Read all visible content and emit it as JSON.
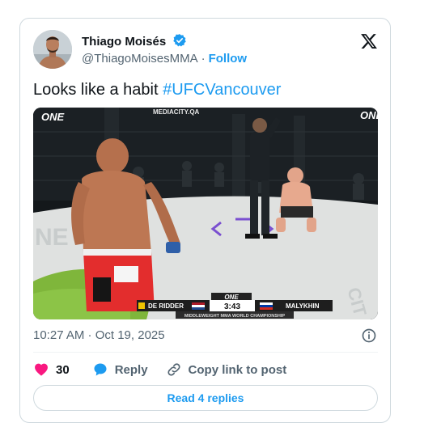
{
  "author": {
    "name": "Thiago Moisés",
    "handle": "@ThiagoMoisesMMA",
    "separator": "·",
    "follow_label": "Follow"
  },
  "tweet": {
    "text": "Looks like a habit ",
    "hashtag": "#UFCVancouver",
    "timestamp": "10:27 AM · Oct 19, 2025"
  },
  "media": {
    "brand_left": "ONE",
    "brand_right": "ONE",
    "sponsor_banner": "MEDIACITY.QA",
    "canvas_ring_text": "NE",
    "canvas_right_text": "CIT",
    "scoreboard": {
      "brand": "ONE",
      "fighter_left": "DE RIDDER",
      "fighter_right": "MALYKHIN",
      "clock": "3:43",
      "title": "MIDDLEWEIGHT MMA WORLD CHAMPIONSHIP"
    }
  },
  "actions": {
    "like_count": "30",
    "reply_label": "Reply",
    "copy_label": "Copy link to post"
  },
  "read_replies_label": "Read 4 replies",
  "colors": {
    "accent": "#1d9bf0",
    "like": "#f91880",
    "text": "#0f1419",
    "muted": "#536471",
    "border": "#cfd9de"
  },
  "icons": [
    "verified-badge-icon",
    "x-logo-icon",
    "info-icon",
    "heart-icon",
    "reply-bubble-icon",
    "link-icon"
  ]
}
